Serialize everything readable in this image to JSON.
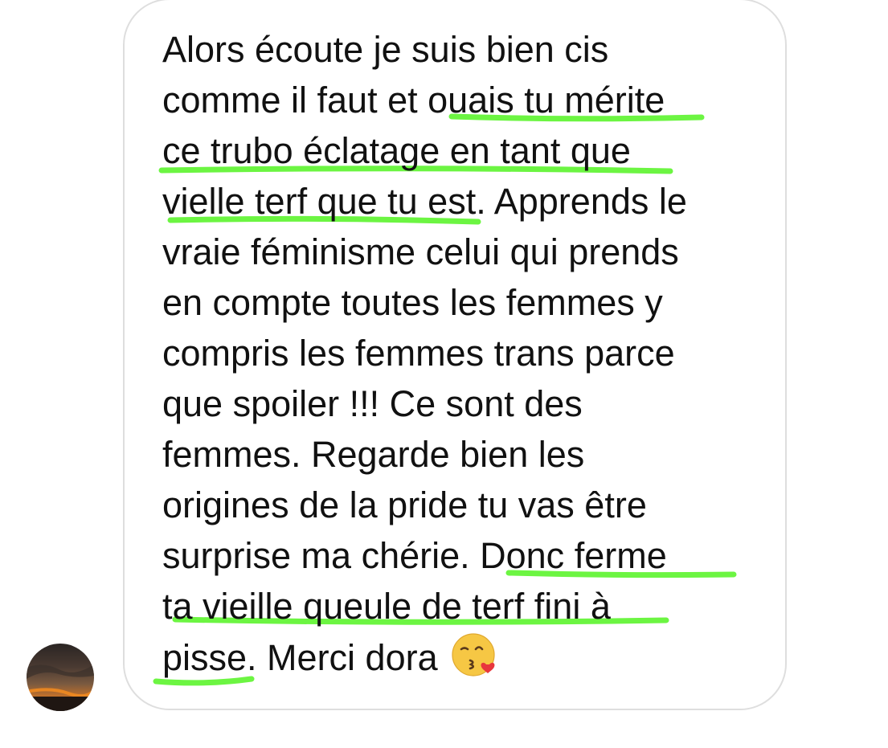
{
  "message": {
    "lines": [
      "Alors écoute je suis bien cis",
      "comme il faut et ouais tu mérite",
      "ce trubo éclatage en tant que",
      "vielle terf que tu est. Apprends le",
      "vraie féminisme celui qui prends",
      "en compte toutes les femmes y",
      "compris les femmes trans parce",
      "que spoiler !!! Ce sont des",
      "femmes. Regarde bien les",
      "origines de la pride tu vas être",
      "surprise ma chérie. Donc ferme",
      "ta vieille queule de terf fini à",
      "pisse. Merci dora"
    ],
    "emoji": "😘"
  },
  "colors": {
    "highlight": "#6cf542",
    "bubble_border": "#dedede",
    "text": "#111111"
  },
  "icons": {
    "avatar": "sunset-avatar",
    "emoji": "kissing-face-with-heart-emoji"
  }
}
